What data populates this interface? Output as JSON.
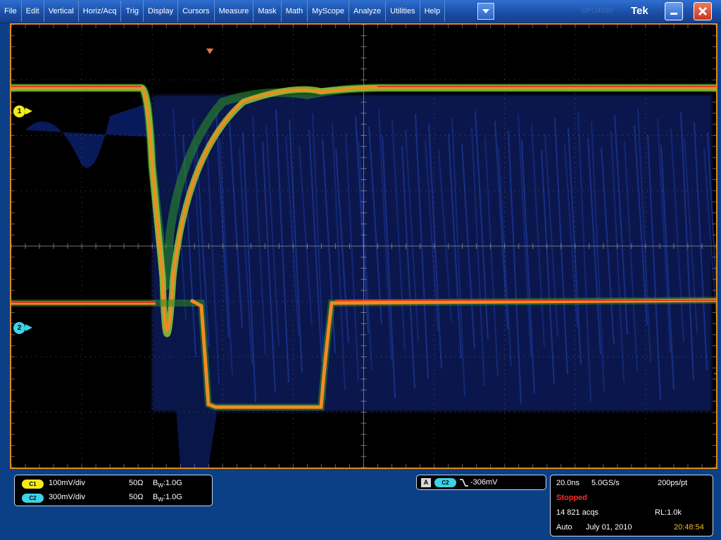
{
  "menu": {
    "items": [
      "File",
      "Edit",
      "Vertical",
      "Horiz/Acq",
      "Trig",
      "Display",
      "Cursors",
      "Measure",
      "Mask",
      "Math",
      "MyScope",
      "Analyze",
      "Utilities",
      "Help"
    ],
    "ghost_text": "DPO4030",
    "brand": "Tek"
  },
  "icons": {
    "dropdown": "chevron-down-icon",
    "minimize": "minimize-icon",
    "close": "close-icon"
  },
  "colors": {
    "frame_border": "#e08a1e",
    "ch1": "#f2ea1a",
    "ch2": "#3cd3e6",
    "stopped": "#ff2a2a",
    "clock": "#f5b733",
    "menu_bg": "#1a4fa6"
  },
  "scope": {
    "ch1_marker": "1",
    "ch2_marker": "2",
    "trigger_level_marker": "←"
  },
  "channels": [
    {
      "pill": "C1",
      "scale": "100mV/div",
      "impedance": "50Ω",
      "bw_label": "B",
      "bw_sub": "W",
      "bw_value": ":1.0G"
    },
    {
      "pill": "C2",
      "scale": "300mV/div",
      "impedance": "50Ω",
      "bw_label": "B",
      "bw_sub": "W",
      "bw_value": ":1.0G"
    }
  ],
  "trigger": {
    "mode_box": "A",
    "source_pill": "C2",
    "slope_icon": "falling-edge-icon",
    "level": "-306mV"
  },
  "acquisition": {
    "timebase": "20.0ns",
    "sample_rate": "5.0GS/s",
    "resolution": "200ps/pt",
    "state": "Stopped",
    "acqs": "14 821 acqs",
    "record_length": "RL:1.0k",
    "mode": "Auto",
    "date": "July 01, 2010",
    "time": "20:48:54"
  }
}
